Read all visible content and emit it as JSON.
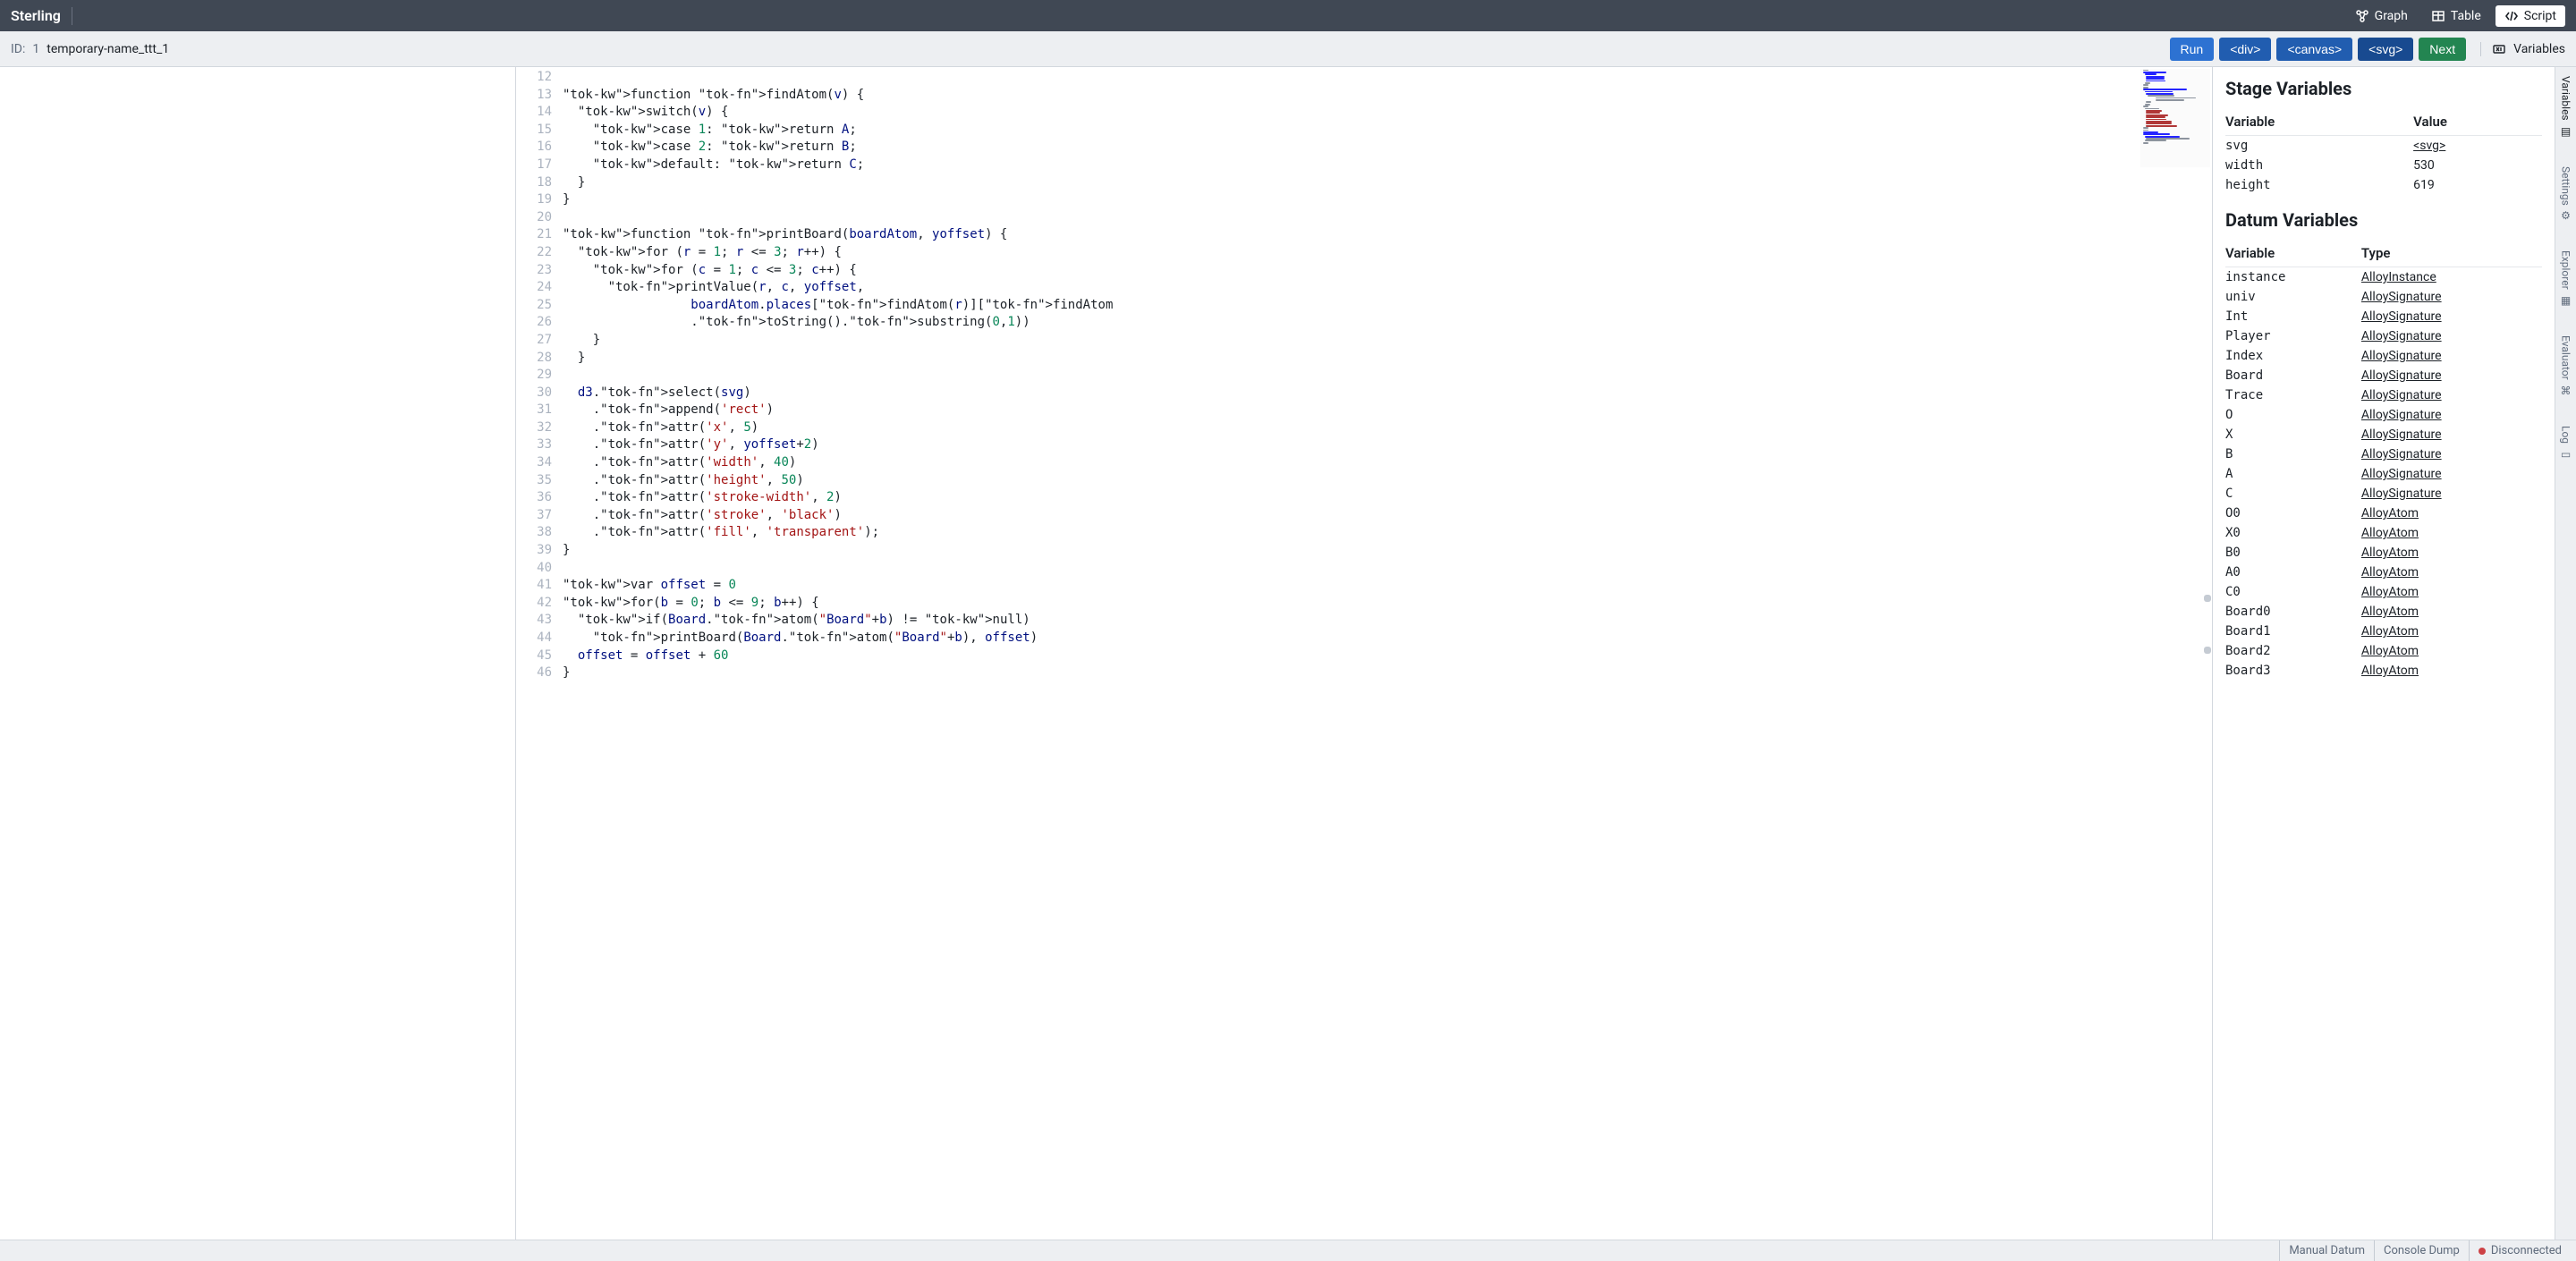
{
  "brand": "Sterling",
  "topbar": {
    "graph": "Graph",
    "table": "Table",
    "script": "Script"
  },
  "subbar": {
    "id_label": "ID:",
    "id_value": "1",
    "name": "temporary-name_ttt_1",
    "run": "Run",
    "div": "<div>",
    "canvas": "<canvas>",
    "svg": "<svg>",
    "next": "Next",
    "variables": "Variables"
  },
  "editor": {
    "first_line": 12,
    "lines": [
      "",
      "function findAtom(v) {",
      "  switch(v) {",
      "    case 1: return A;",
      "    case 2: return B;",
      "    default: return C;",
      "  }",
      "}",
      "",
      "function printBoard(boardAtom, yoffset) {",
      "  for (r = 1; r <= 3; r++) {",
      "    for (c = 1; c <= 3; c++) {",
      "      printValue(r, c, yoffset,",
      "                 boardAtom.places[findAtom(r)][findAtom",
      "                 .toString().substring(0,1))",
      "    }",
      "  }",
      "",
      "  d3.select(svg)",
      "    .append('rect')",
      "    .attr('x', 5)",
      "    .attr('y', yoffset+2)",
      "    .attr('width', 40)",
      "    .attr('height', 50)",
      "    .attr('stroke-width', 2)",
      "    .attr('stroke', 'black')",
      "    .attr('fill', 'transparent');",
      "}",
      "",
      "var offset = 0",
      "for(b = 0; b <= 9; b++) {",
      "  if(Board.atom(\"Board\"+b) != null)",
      "    printBoard(Board.atom(\"Board\"+b), offset)",
      "  offset = offset + 60",
      "}"
    ]
  },
  "variables_panel": {
    "stage_heading": "Stage Variables",
    "col_variable": "Variable",
    "col_value": "Value",
    "col_type": "Type",
    "stage_vars": [
      {
        "name": "svg",
        "value": "<svg>",
        "link": true
      },
      {
        "name": "width",
        "value": "530",
        "link": false
      },
      {
        "name": "height",
        "value": "619",
        "link": false
      }
    ],
    "datum_heading": "Datum Variables",
    "datum_vars": [
      {
        "name": "instance",
        "type": "AlloyInstance"
      },
      {
        "name": "univ",
        "type": "AlloySignature"
      },
      {
        "name": "Int",
        "type": "AlloySignature"
      },
      {
        "name": "Player",
        "type": "AlloySignature"
      },
      {
        "name": "Index",
        "type": "AlloySignature"
      },
      {
        "name": "Board",
        "type": "AlloySignature"
      },
      {
        "name": "Trace",
        "type": "AlloySignature"
      },
      {
        "name": "O",
        "type": "AlloySignature"
      },
      {
        "name": "X",
        "type": "AlloySignature"
      },
      {
        "name": "B",
        "type": "AlloySignature"
      },
      {
        "name": "A",
        "type": "AlloySignature"
      },
      {
        "name": "C",
        "type": "AlloySignature"
      },
      {
        "name": "O0",
        "type": "AlloyAtom"
      },
      {
        "name": "X0",
        "type": "AlloyAtom"
      },
      {
        "name": "B0",
        "type": "AlloyAtom"
      },
      {
        "name": "A0",
        "type": "AlloyAtom"
      },
      {
        "name": "C0",
        "type": "AlloyAtom"
      },
      {
        "name": "Board0",
        "type": "AlloyAtom"
      },
      {
        "name": "Board1",
        "type": "AlloyAtom"
      },
      {
        "name": "Board2",
        "type": "AlloyAtom"
      },
      {
        "name": "Board3",
        "type": "AlloyAtom"
      }
    ]
  },
  "rail": {
    "variables": "Variables",
    "settings": "Settings",
    "explorer": "Explorer",
    "evaluator": "Evaluator",
    "log": "Log"
  },
  "statusbar": {
    "manual_datum": "Manual Datum",
    "console_dump": "Console Dump",
    "disconnected": "Disconnected"
  }
}
